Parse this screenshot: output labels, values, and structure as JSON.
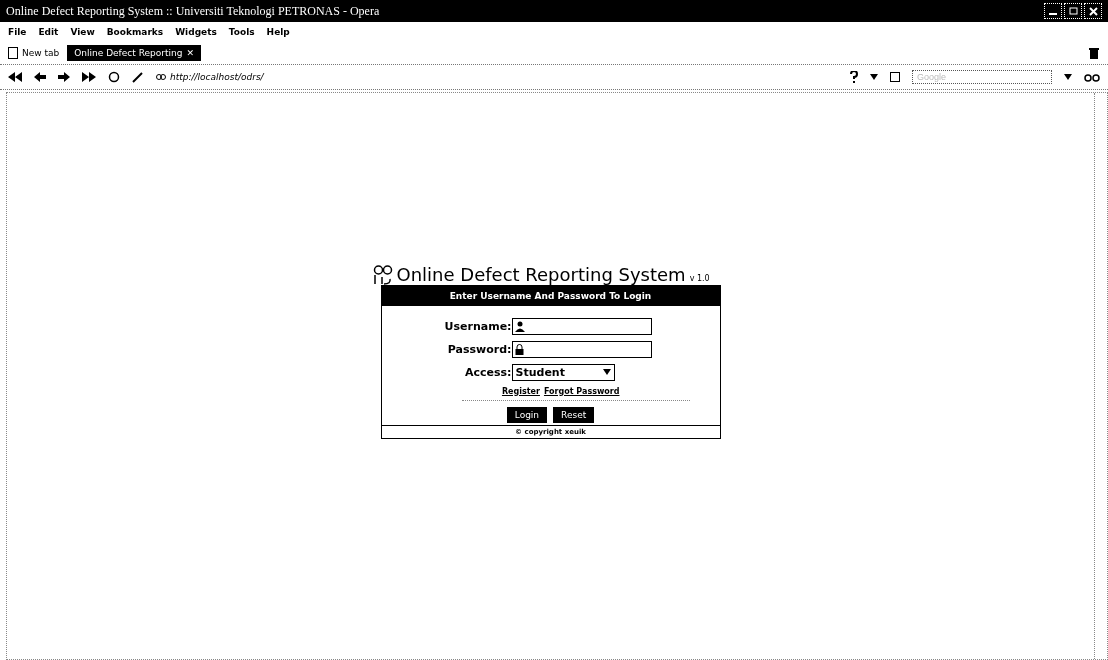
{
  "window": {
    "title": "Online Defect Reporting System :: Universiti Teknologi PETRONAS - Opera"
  },
  "menu": [
    "File",
    "Edit",
    "View",
    "Bookmarks",
    "Widgets",
    "Tools",
    "Help"
  ],
  "tabs": [
    {
      "label": "New tab",
      "kind": "new"
    },
    {
      "label": "Online Defect Reporting",
      "kind": "page",
      "selected": true,
      "close": "✕"
    }
  ],
  "address": {
    "value": "http://localhost/odrs/"
  },
  "search": {
    "placeholder": "Google"
  },
  "login": {
    "title": "Online Defect Reporting System",
    "version": "v 1.0",
    "header": "Enter Username And Password To Login",
    "fields": [
      {
        "label": "Username:",
        "kind": "user"
      },
      {
        "label": "Password:",
        "kind": "lock"
      },
      {
        "label": "Access:",
        "kind": "select",
        "value": "Student"
      }
    ],
    "links": [
      "Register",
      "Forgot Password"
    ],
    "buttons": [
      "Login",
      "Reset"
    ],
    "footer": "© copyright xeuik"
  }
}
